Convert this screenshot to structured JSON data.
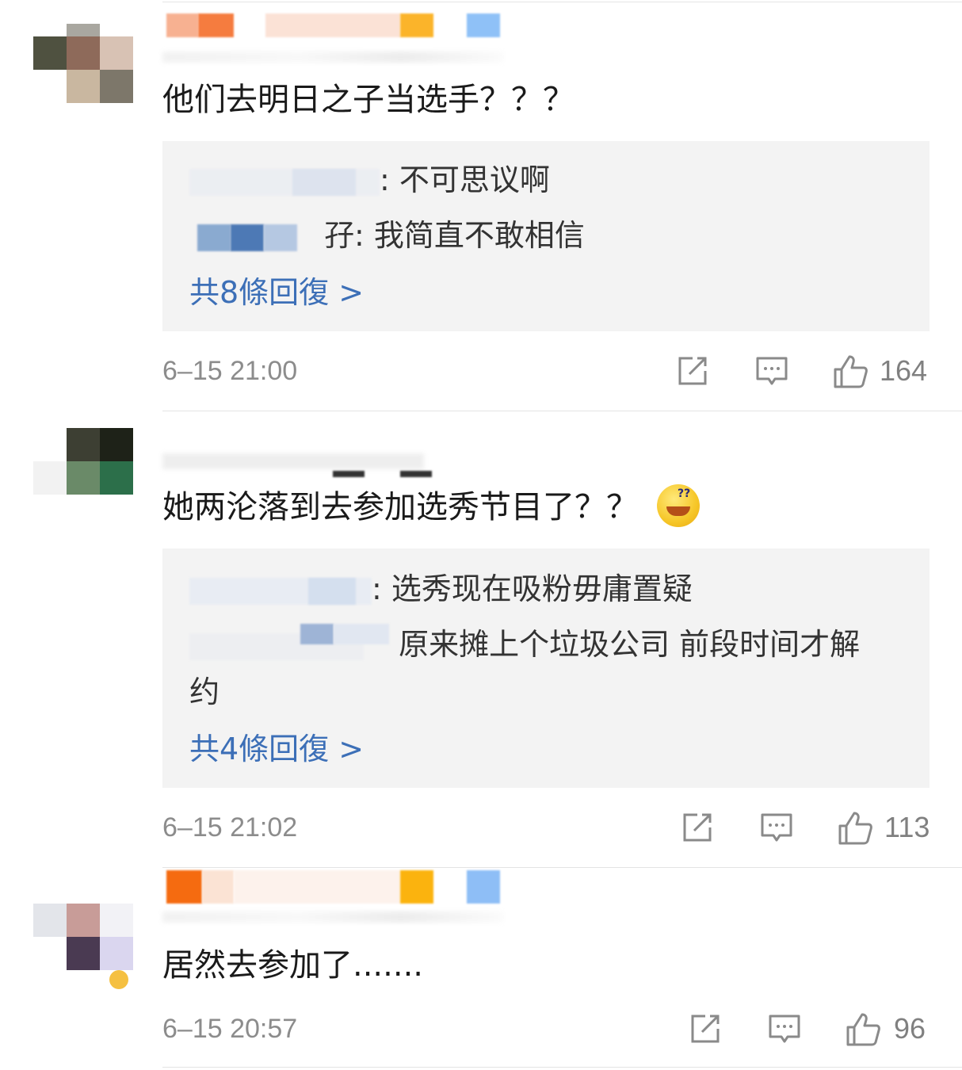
{
  "comments": [
    {
      "text": "他们去明日之子当选手？？？",
      "replies": [
        {
          "name_tail": ":",
          "text": "不可思议啊"
        },
        {
          "name_tail": "孖:",
          "text": "我简直不敢相信"
        }
      ],
      "more_replies": "共8條回復 >",
      "time": "6–15 21:00",
      "likes": "164"
    },
    {
      "text": "她两沦落到去参加选秀节目了？？",
      "emoji": "dizzy-grin-emoji",
      "replies": [
        {
          "name_tail": ":",
          "text": "选秀现在吸粉毋庸置疑"
        },
        {
          "name_tail": "",
          "text": "原来摊上个垃圾公司 前段时间才解",
          "text_cont": "约"
        }
      ],
      "more_replies": "共4條回復 >",
      "time": "6–15 21:02",
      "likes": "113"
    },
    {
      "text": "居然去参加了.......",
      "time": "6–15 20:57",
      "likes": "96"
    }
  ],
  "icons": {
    "share": "share-icon",
    "reply": "comment-icon",
    "like": "thumbs-up-icon"
  },
  "colors": {
    "link": "#3c6fb7",
    "meta": "#8c8c8c",
    "reply_bg": "#f3f3f3"
  }
}
